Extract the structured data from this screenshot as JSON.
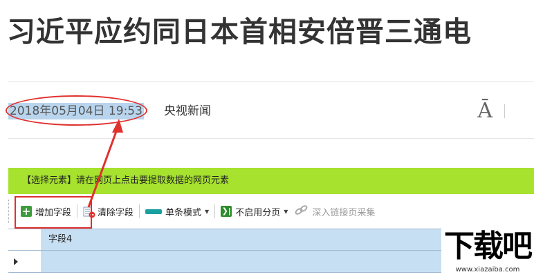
{
  "article": {
    "headline": "习近平应约同日本首相安倍晋三通电",
    "date": "2018年05月04日 19:53",
    "source": "央视新闻",
    "font_size_icon": "font-size-icon"
  },
  "hint_bar": {
    "text": "【选择元素】请在网页上点击要提取数据的网页元素",
    "color": "#a6e22e"
  },
  "toolbar": {
    "add_field": "增加字段",
    "clear_fields": "清除字段",
    "single_mode": "单条模式",
    "no_paging": "不启用分页",
    "deep_link": "深入链接页采集"
  },
  "grid": {
    "columns": [
      "字段4"
    ]
  },
  "annotations": {
    "color": "#e0312e"
  },
  "watermark": {
    "logo": "下载吧",
    "url": "www.xiazaiba.com"
  }
}
